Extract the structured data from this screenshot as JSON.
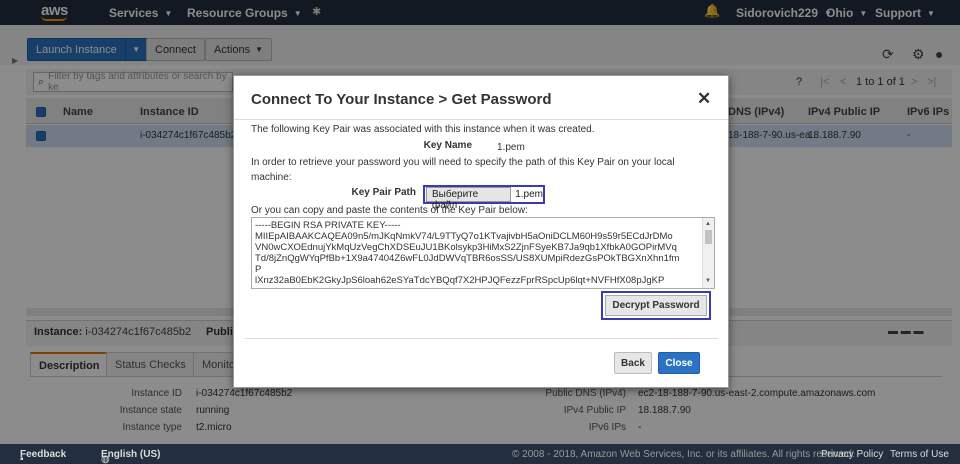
{
  "topnav": {
    "logo": "aws",
    "services": "Services",
    "resource_groups": "Resource Groups",
    "user": "Sidorovich229",
    "region": "Ohio",
    "support": "Support"
  },
  "toolbar": {
    "launch_instance": "Launch Instance",
    "connect": "Connect",
    "actions": "Actions"
  },
  "filter": {
    "placeholder": "Filter by tags and attributes or search by ke",
    "pagination": "1 to 1 of 1"
  },
  "table": {
    "headers": [
      "Name",
      "Instance ID",
      "DNS (IPv4)",
      "IPv4 Public IP",
      "IPv6 IPs"
    ],
    "row": {
      "instance_id": "i-034274c1f67c485b2",
      "dns": "18-188-7-90.us-ea...",
      "public_ip": "18.188.7.90",
      "ipv6": "-"
    }
  },
  "details": {
    "instance_label": "Instance:",
    "instance_value": "i-034274c1f67c485b2",
    "public_label": "Publi",
    "tabs": [
      "Description",
      "Status Checks",
      "Monito"
    ],
    "left": [
      {
        "label": "Instance ID",
        "value": "i-034274c1f67c485b2"
      },
      {
        "label": "Instance state",
        "value": "running"
      },
      {
        "label": "Instance type",
        "value": "t2.micro"
      }
    ],
    "right": [
      {
        "label": "Public DNS (IPv4)",
        "value": "ec2-18-188-7-90.us-east-2.compute.amazonaws.com"
      },
      {
        "label": "IPv4 Public IP",
        "value": "18.188.7.90"
      },
      {
        "label": "IPv6 IPs",
        "value": "-"
      }
    ]
  },
  "footer": {
    "feedback": "Feedback",
    "language": "English (US)",
    "copyright": "© 2008 - 2018, Amazon Web Services, Inc. or its affiliates. All rights reserved.",
    "privacy": "Privacy Policy",
    "terms": "Terms of Use"
  },
  "modal": {
    "title": "Connect To Your Instance > Get Password",
    "intro": "The following Key Pair was associated with this instance when it was created.",
    "key_name_label": "Key Name",
    "key_name_value": "1.pem",
    "instructions_1": "In order to retrieve your password you will need to specify the path of this Key Pair on your local",
    "instructions_2": "machine:",
    "key_pair_path_label": "Key Pair Path",
    "file_button": "Выберите файл",
    "file_name": "1.pem",
    "paste_hint": "Or you can copy and paste the contents of the Key Pair below:",
    "key_lines": [
      "-----BEGIN RSA PRIVATE KEY-----",
      "MIIEpAIBAAKCAQEA09n5/mJKqNmkV74/L9TTyQ7o1KTvajivbH5aOniDCLM60H9s59r5ECdJrDMo",
      "VN0wCXOEdnujYkMqUzVegChXDSEuJU1BKolsykp3HiMxS2ZjnFSyeKB7Ja9qb1XfbkA0GOPirMVq",
      "Td/8jZnQgWYqPfBb+1X9a47404Z6wFL0JdDWVqTBR6osSS/US8XUMpiRdezGsPOkTBGXnXhn1fm",
      "P",
      "lXnz32aB0EbK2GkyJpS6loah62eSYaTdcYBQqf7X2HPJQFezzFprRSpcUp6lqt+NVFHfX08pJgKP"
    ],
    "decrypt_button": "Decrypt Password",
    "back_button": "Back",
    "close_button": "Close"
  }
}
